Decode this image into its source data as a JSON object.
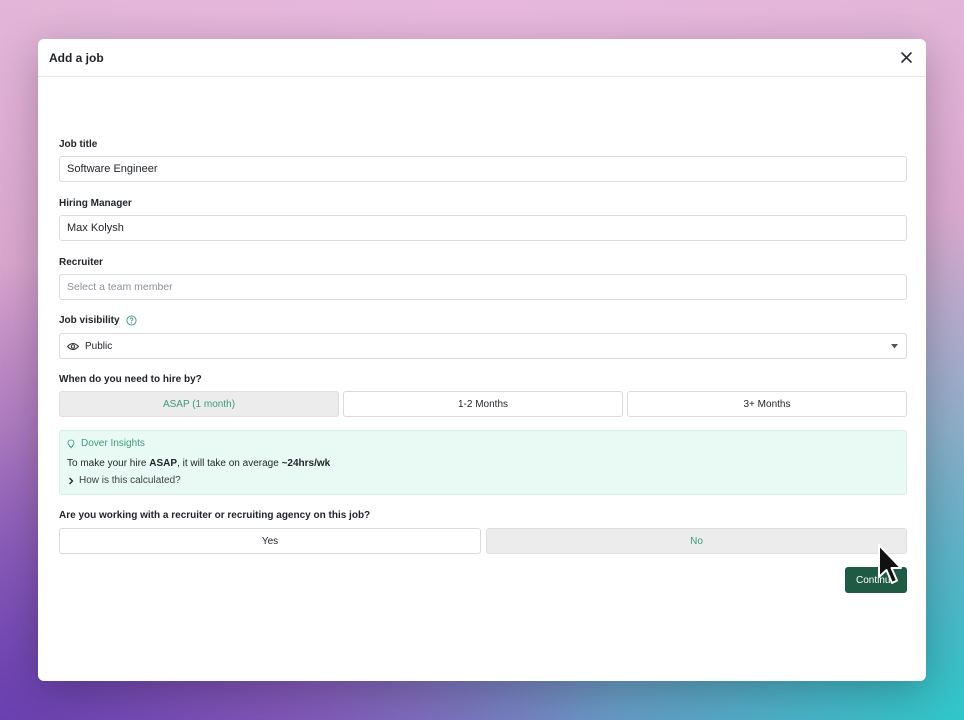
{
  "modal": {
    "title": "Add a job"
  },
  "form": {
    "job_title": {
      "label": "Job title",
      "value": "Software Engineer"
    },
    "hiring_manager": {
      "label": "Hiring Manager",
      "value": "Max Kolysh"
    },
    "recruiter": {
      "label": "Recruiter",
      "placeholder": "Select a team member"
    },
    "job_visibility": {
      "label": "Job visibility",
      "value": "Public"
    },
    "hire_by": {
      "label": "When do you need to hire by?",
      "options": [
        "ASAP (1 month)",
        "1-2 Months",
        "3+ Months"
      ],
      "selected": "ASAP (1 month)"
    },
    "insights": {
      "title": "Dover Insights",
      "text_prefix": "To make your hire ",
      "text_bold1": "ASAP",
      "text_middle": ", it will take on average ",
      "text_bold2": "~24hrs/wk",
      "link": "How is this calculated?"
    },
    "agency": {
      "label": "Are you working with a recruiter or recruiting agency on this job?",
      "options": [
        "Yes",
        "No"
      ],
      "selected": "No"
    },
    "continue_label": "Continue"
  },
  "colors": {
    "accent": "#3f9a78",
    "primary_button": "#1f5a45",
    "insights_bg": "#e9faf5"
  },
  "icons": [
    "close-icon",
    "help-circle-icon",
    "eye-icon",
    "caret-down-icon",
    "lightbulb-icon",
    "chevron-right-icon",
    "mouse-pointer-icon"
  ]
}
